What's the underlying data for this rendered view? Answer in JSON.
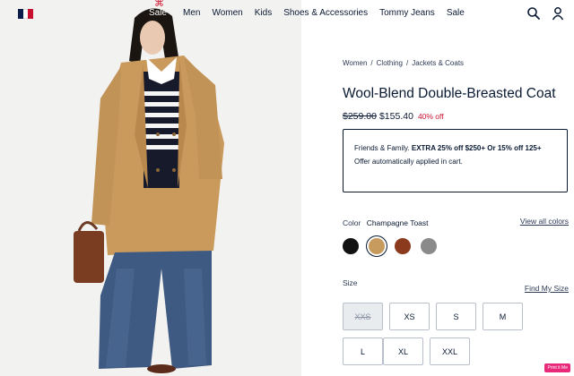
{
  "header": {
    "sale_highlight": "Sale",
    "nav": [
      "Men",
      "Women",
      "Kids",
      "Shoes & Accessories",
      "Tommy Jeans",
      "Sale"
    ]
  },
  "icons": {
    "logo": "flag-logo-icon",
    "search": "search-icon",
    "account": "account-icon"
  },
  "breadcrumb": [
    "Women",
    "Clothing",
    "Jackets & Coats"
  ],
  "product": {
    "title": "Wool-Blend Double-Breasted Coat",
    "price_original": "$259.00",
    "price_current": "$155.40",
    "discount": "40% off"
  },
  "promo": {
    "lead": "Friends & Family.",
    "offer": "EXTRA 25% off $250+ Or 15% off 125+",
    "note": "Offer automatically applied in cart."
  },
  "color": {
    "label": "Color",
    "selected": "Champagne Toast",
    "view_all": "View all colors",
    "swatches": [
      {
        "name": "black",
        "hex": "#111111",
        "selected": false
      },
      {
        "name": "champagne-toast",
        "hex": "#c79a5e",
        "selected": true
      },
      {
        "name": "brown",
        "hex": "#8b3a1e",
        "selected": false
      },
      {
        "name": "grey",
        "hex": "#8a8a8a",
        "selected": false
      }
    ]
  },
  "size": {
    "label": "Size",
    "guide": "Find My Size",
    "options": [
      {
        "label": "XXS",
        "available": false
      },
      {
        "label": "XS",
        "available": true
      },
      {
        "label": "S",
        "available": true
      },
      {
        "label": "M",
        "available": true
      },
      {
        "label": "L",
        "available": true
      },
      {
        "label": "XL",
        "available": true
      },
      {
        "label": "XXL",
        "available": true
      }
    ]
  },
  "badge": "Print it Me",
  "colors": {
    "navy": "#0a1a33",
    "red": "#c8102e"
  }
}
